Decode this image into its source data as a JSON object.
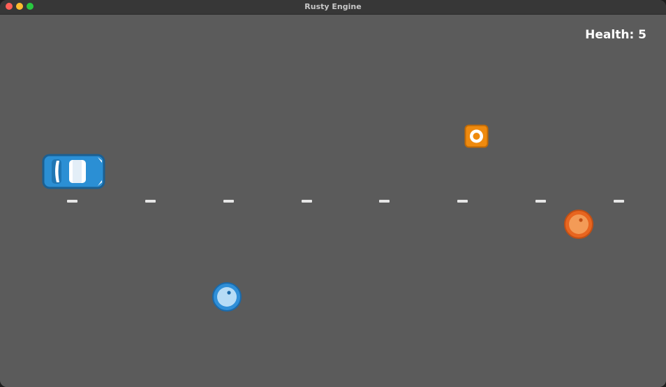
{
  "window": {
    "title": "Rusty Engine"
  },
  "hud": {
    "health_text": "Health: 5"
  },
  "sprites": {
    "player": {
      "kind": "blue car"
    },
    "box": {
      "kind": "orange box obstacle"
    },
    "ball_orange": {
      "kind": "orange ball"
    },
    "ball_blue": {
      "kind": "blue ball"
    }
  },
  "road": {
    "lane_dash_count": 8
  },
  "colors": {
    "road": "#5b5b5b",
    "lane_marking": "#e6e6e6",
    "car_blue": "#2b8fd4",
    "box_orange": "#ef8a0e",
    "ball_orange": "#e8651f",
    "ball_blue": "#2f8fd8"
  }
}
